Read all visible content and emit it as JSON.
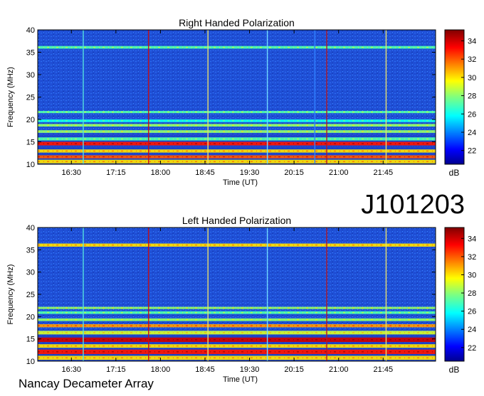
{
  "figure": {
    "event_id": "J101203",
    "instrument": "Nancay Decameter Array"
  },
  "chart_data": [
    {
      "type": "heatmap",
      "title": "Right Handed Polarization",
      "xlabel": "Time (UT)",
      "ylabel": "Frequency (MHz)",
      "x_ticks": [
        "16:30",
        "17:15",
        "18:00",
        "18:45",
        "19:30",
        "20:15",
        "21:00",
        "21:45"
      ],
      "x_range": [
        "15:56",
        "22:38"
      ],
      "y_ticks": [
        10,
        15,
        20,
        25,
        30,
        35,
        40
      ],
      "ylim": [
        10,
        40
      ],
      "colorbar": {
        "label": "dB",
        "ticks": [
          22,
          24,
          26,
          28,
          30,
          32,
          34
        ],
        "range": [
          20.5,
          35.2
        ],
        "colormap": "jet"
      },
      "emission_bands_mhz": [
        {
          "from": 10.2,
          "to": 11.0,
          "level": 30
        },
        {
          "from": 11.3,
          "to": 12.0,
          "level": 32
        },
        {
          "from": 12.6,
          "to": 13.3,
          "level": 30
        },
        {
          "from": 14.2,
          "to": 15.0,
          "level": 33
        },
        {
          "from": 15.3,
          "to": 16.0,
          "level": 27
        },
        {
          "from": 17.0,
          "to": 17.6,
          "level": 28
        },
        {
          "from": 18.4,
          "to": 19.0,
          "level": 28
        },
        {
          "from": 19.4,
          "to": 20.0,
          "level": 26
        },
        {
          "from": 21.4,
          "to": 21.9,
          "level": 27
        },
        {
          "from": 35.8,
          "to": 36.4,
          "level": 27
        }
      ],
      "interference_times": [
        {
          "time": "16:42",
          "color": "#55e0e0"
        },
        {
          "time": "17:48",
          "color": "#c0101e"
        },
        {
          "time": "18:48",
          "color": "#e8e070"
        },
        {
          "time": "19:48",
          "color": "#6fd8ff"
        },
        {
          "time": "20:36",
          "color": "#3080ff"
        },
        {
          "time": "20:48",
          "color": "#b01828"
        },
        {
          "time": "21:48",
          "color": "#e8e070"
        }
      ]
    },
    {
      "type": "heatmap",
      "title": "Left Handed Polarization",
      "xlabel": "Time (UT)",
      "ylabel": "Frequency (MHz)",
      "x_ticks": [
        "16:30",
        "17:15",
        "18:00",
        "18:45",
        "19:30",
        "20:15",
        "21:00",
        "21:45"
      ],
      "x_range": [
        "15:56",
        "22:38"
      ],
      "y_ticks": [
        10,
        15,
        20,
        25,
        30,
        35,
        40
      ],
      "ylim": [
        10,
        40
      ],
      "colorbar": {
        "label": "dB",
        "ticks": [
          22,
          24,
          26,
          28,
          30,
          32,
          34
        ],
        "range": [
          20.5,
          35.2
        ],
        "colormap": "jet"
      },
      "emission_bands_mhz": [
        {
          "from": 10.3,
          "to": 11.2,
          "level": 30
        },
        {
          "from": 11.6,
          "to": 12.6,
          "level": 33
        },
        {
          "from": 13.0,
          "to": 13.8,
          "level": 30
        },
        {
          "from": 14.3,
          "to": 15.3,
          "level": 34
        },
        {
          "from": 16.0,
          "to": 16.8,
          "level": 29
        },
        {
          "from": 17.6,
          "to": 18.3,
          "level": 31
        },
        {
          "from": 19.0,
          "to": 19.6,
          "level": 28
        },
        {
          "from": 20.6,
          "to": 21.2,
          "level": 27
        },
        {
          "from": 21.7,
          "to": 22.2,
          "level": 28
        },
        {
          "from": 35.7,
          "to": 36.4,
          "level": 30
        }
      ],
      "interference_times": [
        {
          "time": "16:42",
          "color": "#55e0e0"
        },
        {
          "time": "17:48",
          "color": "#c0101e"
        },
        {
          "time": "18:48",
          "color": "#e8e070"
        },
        {
          "time": "19:48",
          "color": "#6fd8ff"
        },
        {
          "time": "20:48",
          "color": "#b01828"
        },
        {
          "time": "21:48",
          "color": "#e8e070"
        }
      ]
    }
  ]
}
